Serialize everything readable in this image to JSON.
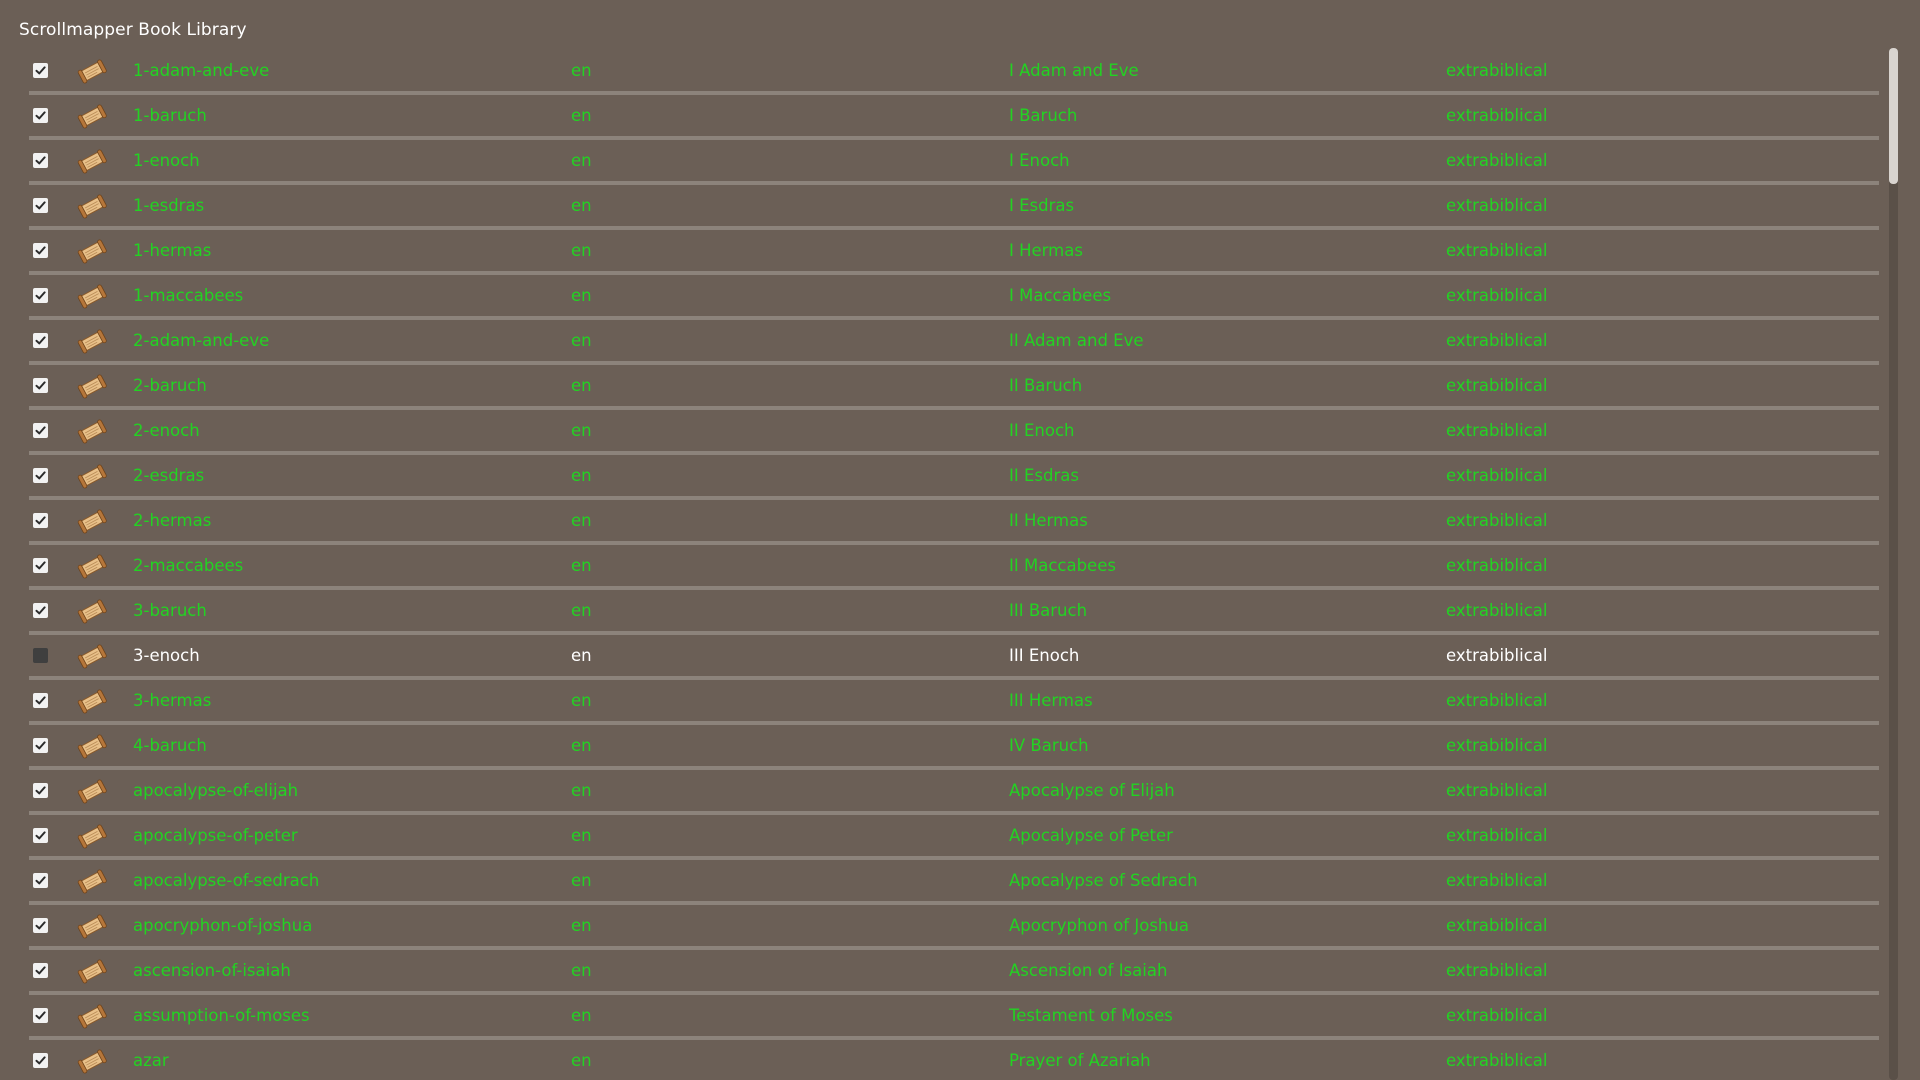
{
  "window": {
    "title": "Scrollmapper Book Library"
  },
  "colors": {
    "enabled_text": "#22d322",
    "disabled_text": "#ffffff",
    "background": "#6b5f56",
    "row_divider": "#8c837b"
  },
  "books": [
    {
      "slug": "1-adam-and-eve",
      "lang": "en",
      "name": "I Adam and Eve",
      "category": "extrabiblical",
      "checked": true,
      "icon": "scroll-icon"
    },
    {
      "slug": "1-baruch",
      "lang": "en",
      "name": "I Baruch",
      "category": "extrabiblical",
      "checked": true,
      "icon": "scroll-icon"
    },
    {
      "slug": "1-enoch",
      "lang": "en",
      "name": "I Enoch",
      "category": "extrabiblical",
      "checked": true,
      "icon": "scroll-icon"
    },
    {
      "slug": "1-esdras",
      "lang": "en",
      "name": "I Esdras",
      "category": "extrabiblical",
      "checked": true,
      "icon": "scroll-icon"
    },
    {
      "slug": "1-hermas",
      "lang": "en",
      "name": "I Hermas",
      "category": "extrabiblical",
      "checked": true,
      "icon": "scroll-icon"
    },
    {
      "slug": "1-maccabees",
      "lang": "en",
      "name": "I Maccabees",
      "category": "extrabiblical",
      "checked": true,
      "icon": "scroll-icon"
    },
    {
      "slug": "2-adam-and-eve",
      "lang": "en",
      "name": "II Adam and Eve",
      "category": "extrabiblical",
      "checked": true,
      "icon": "scroll-icon"
    },
    {
      "slug": "2-baruch",
      "lang": "en",
      "name": "II Baruch",
      "category": "extrabiblical",
      "checked": true,
      "icon": "scroll-icon"
    },
    {
      "slug": "2-enoch",
      "lang": "en",
      "name": "II Enoch",
      "category": "extrabiblical",
      "checked": true,
      "icon": "scroll-icon"
    },
    {
      "slug": "2-esdras",
      "lang": "en",
      "name": "II Esdras",
      "category": "extrabiblical",
      "checked": true,
      "icon": "scroll-icon"
    },
    {
      "slug": "2-hermas",
      "lang": "en",
      "name": "II Hermas",
      "category": "extrabiblical",
      "checked": true,
      "icon": "scroll-icon"
    },
    {
      "slug": "2-maccabees",
      "lang": "en",
      "name": "II Maccabees",
      "category": "extrabiblical",
      "checked": true,
      "icon": "scroll-icon"
    },
    {
      "slug": "3-baruch",
      "lang": "en",
      "name": "III Baruch",
      "category": "extrabiblical",
      "checked": true,
      "icon": "scroll-icon"
    },
    {
      "slug": "3-enoch",
      "lang": "en",
      "name": "III Enoch",
      "category": "extrabiblical",
      "checked": false,
      "icon": "scroll-icon"
    },
    {
      "slug": "3-hermas",
      "lang": "en",
      "name": "III Hermas",
      "category": "extrabiblical",
      "checked": true,
      "icon": "scroll-icon"
    },
    {
      "slug": "4-baruch",
      "lang": "en",
      "name": "IV Baruch",
      "category": "extrabiblical",
      "checked": true,
      "icon": "scroll-icon"
    },
    {
      "slug": "apocalypse-of-elijah",
      "lang": "en",
      "name": "Apocalypse of Elijah",
      "category": "extrabiblical",
      "checked": true,
      "icon": "scroll-icon"
    },
    {
      "slug": "apocalypse-of-peter",
      "lang": "en",
      "name": "Apocalypse of Peter",
      "category": "extrabiblical",
      "checked": true,
      "icon": "scroll-icon"
    },
    {
      "slug": "apocalypse-of-sedrach",
      "lang": "en",
      "name": "Apocalypse of Sedrach",
      "category": "extrabiblical",
      "checked": true,
      "icon": "scroll-icon"
    },
    {
      "slug": "apocryphon-of-joshua",
      "lang": "en",
      "name": "Apocryphon of Joshua",
      "category": "extrabiblical",
      "checked": true,
      "icon": "scroll-icon"
    },
    {
      "slug": "ascension-of-isaiah",
      "lang": "en",
      "name": "Ascension of Isaiah",
      "category": "extrabiblical",
      "checked": true,
      "icon": "scroll-icon"
    },
    {
      "slug": "assumption-of-moses",
      "lang": "en",
      "name": "Testament of Moses",
      "category": "extrabiblical",
      "checked": true,
      "icon": "scroll-icon"
    },
    {
      "slug": "azar",
      "lang": "en",
      "name": "Prayer of Azariah",
      "category": "extrabiblical",
      "checked": true,
      "icon": "scroll-icon"
    }
  ]
}
